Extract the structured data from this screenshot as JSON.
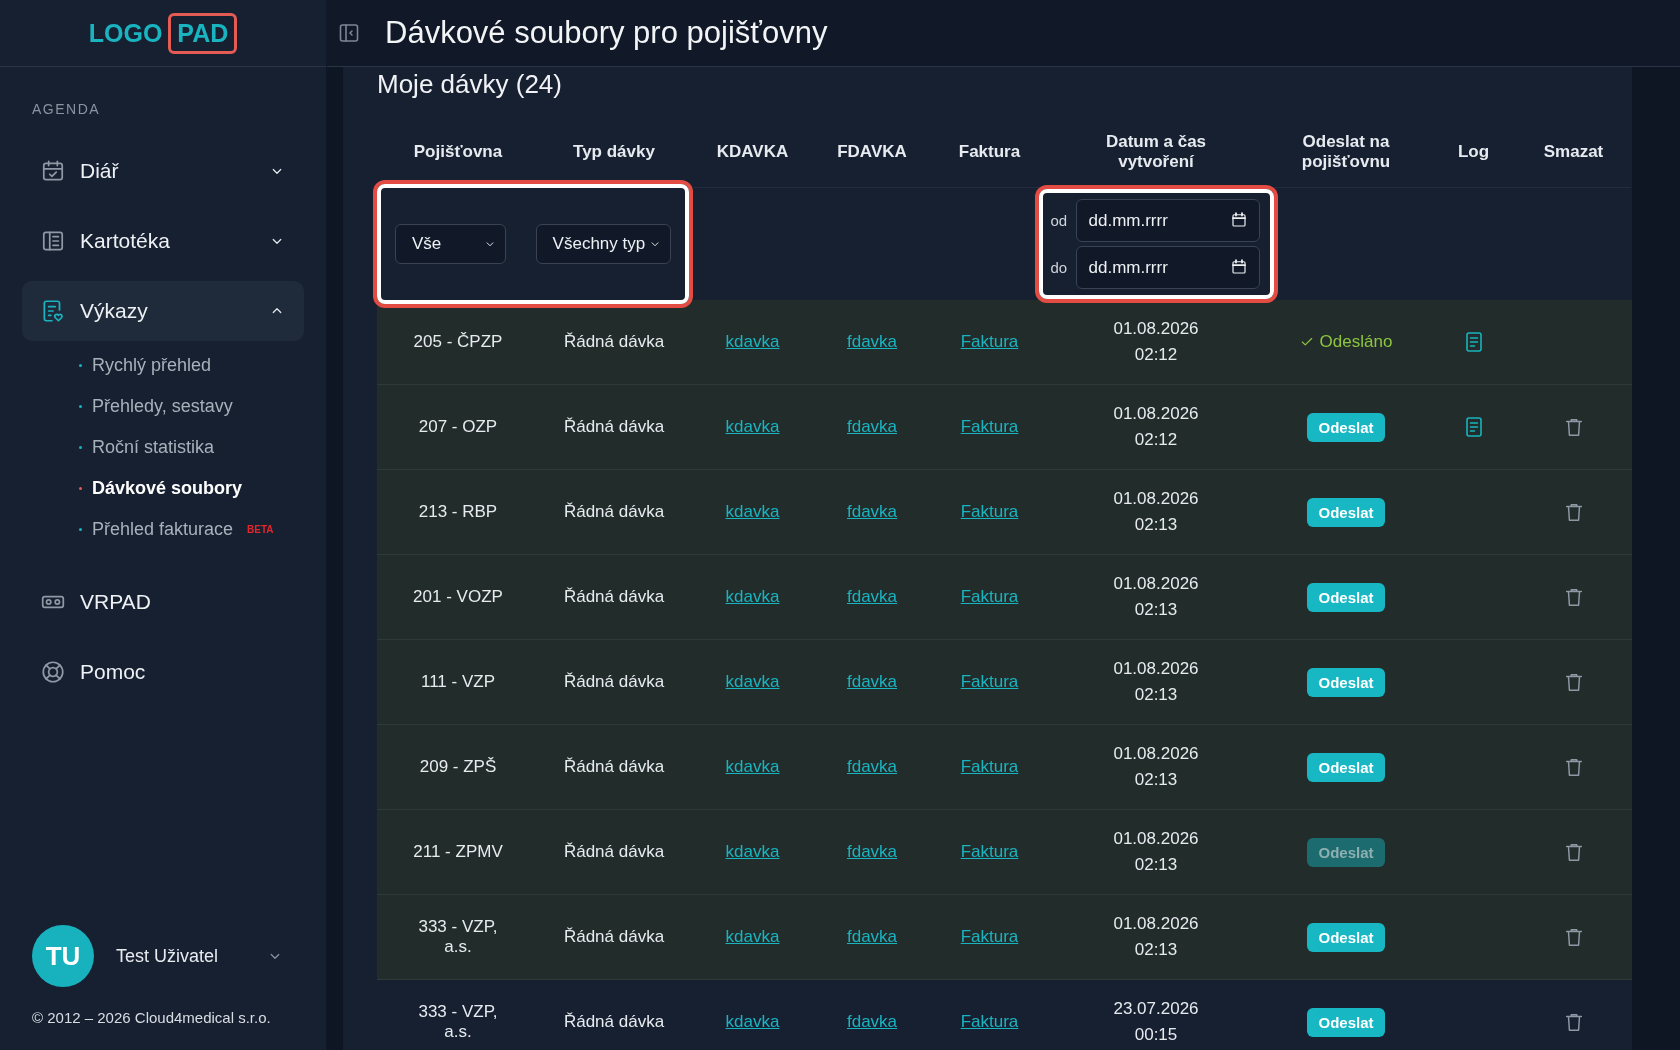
{
  "logo": {
    "text": "LOGO",
    "boxed_text": "PAD"
  },
  "sidebar": {
    "section_label": "AGENDA",
    "items": [
      {
        "label": "Diář",
        "kind": "group",
        "expanded": false,
        "selected": false
      },
      {
        "label": "Kartotéka",
        "kind": "group",
        "expanded": false,
        "selected": false
      },
      {
        "label": "Výkazy",
        "kind": "group",
        "expanded": true,
        "selected": true,
        "children": [
          {
            "label": "Rychlý přehled",
            "selected": false
          },
          {
            "label": "Přehledy, sestavy",
            "selected": false
          },
          {
            "label": "Roční statistika",
            "selected": false
          },
          {
            "label": "Dávkové soubory",
            "selected": true
          },
          {
            "label": "Přehled fakturace",
            "selected": false,
            "badge": "BETA"
          }
        ]
      },
      {
        "label": "VRPAD",
        "kind": "link",
        "selected": false
      },
      {
        "label": "Pomoc",
        "kind": "link",
        "selected": false
      }
    ]
  },
  "user": {
    "initials": "TU",
    "name": "Test Uživatel"
  },
  "copyright": "© 2012 – 2026 Cloud4medical s.r.o.",
  "header": {
    "title": "Dávkové soubory pro pojišťovny"
  },
  "card": {
    "title": "Moje dávky (24)"
  },
  "table": {
    "columns": [
      "Pojišťovna",
      "Typ dávky",
      "KDAVKA",
      "FDAVKA",
      "Faktura",
      "Datum a čas vytvoření",
      "Odeslat na pojišťovnu",
      "Log",
      "Smazat"
    ],
    "filters": {
      "insurer_select": {
        "value": "Vše",
        "highlighted": true
      },
      "type_select": {
        "value": "Všechny typ"
      },
      "date_range": {
        "highlighted": true,
        "from": {
          "label": "od",
          "placeholder": "dd.mm.rrrr"
        },
        "to": {
          "label": "do",
          "placeholder": "dd.mm.rrrr"
        }
      }
    },
    "rows": [
      {
        "insurer": "205 - ČPZP",
        "type": "Řádná dávka",
        "kdavka": "kdavka",
        "fdavka": "fdavka",
        "invoice": "Faktura",
        "date": "01.08.2026",
        "time": "02:12",
        "send": {
          "kind": "sent",
          "label": "Odesláno"
        },
        "has_log": true,
        "deletable": false,
        "highlighted": true
      },
      {
        "insurer": "207 - OZP",
        "type": "Řádná dávka",
        "kdavka": "kdavka",
        "fdavka": "fdavka",
        "invoice": "Faktura",
        "date": "01.08.2026",
        "time": "02:12",
        "send": {
          "kind": "button",
          "label": "Odeslat",
          "disabled": false
        },
        "has_log": true,
        "deletable": true,
        "highlighted": true
      },
      {
        "insurer": "213 - RBP",
        "type": "Řádná dávka",
        "kdavka": "kdavka",
        "fdavka": "fdavka",
        "invoice": "Faktura",
        "date": "01.08.2026",
        "time": "02:13",
        "send": {
          "kind": "button",
          "label": "Odeslat",
          "disabled": false
        },
        "has_log": false,
        "deletable": true,
        "highlighted": true
      },
      {
        "insurer": "201 - VOZP",
        "type": "Řádná dávka",
        "kdavka": "kdavka",
        "fdavka": "fdavka",
        "invoice": "Faktura",
        "date": "01.08.2026",
        "time": "02:13",
        "send": {
          "kind": "button",
          "label": "Odeslat",
          "disabled": false
        },
        "has_log": false,
        "deletable": true,
        "highlighted": true
      },
      {
        "insurer": "111 - VZP",
        "type": "Řádná dávka",
        "kdavka": "kdavka",
        "fdavka": "fdavka",
        "invoice": "Faktura",
        "date": "01.08.2026",
        "time": "02:13",
        "send": {
          "kind": "button",
          "label": "Odeslat",
          "disabled": false
        },
        "has_log": false,
        "deletable": true,
        "highlighted": true
      },
      {
        "insurer": "209 - ZPŠ",
        "type": "Řádná dávka",
        "kdavka": "kdavka",
        "fdavka": "fdavka",
        "invoice": "Faktura",
        "date": "01.08.2026",
        "time": "02:13",
        "send": {
          "kind": "button",
          "label": "Odeslat",
          "disabled": false
        },
        "has_log": false,
        "deletable": true,
        "highlighted": true
      },
      {
        "insurer": "211 - ZPMV",
        "type": "Řádná dávka",
        "kdavka": "kdavka",
        "fdavka": "fdavka",
        "invoice": "Faktura",
        "date": "01.08.2026",
        "time": "02:13",
        "send": {
          "kind": "button",
          "label": "Odeslat",
          "disabled": true
        },
        "has_log": false,
        "deletable": true,
        "highlighted": true
      },
      {
        "insurer": "333 - VZP, a.s.",
        "type": "Řádná dávka",
        "kdavka": "kdavka",
        "fdavka": "fdavka",
        "invoice": "Faktura",
        "date": "01.08.2026",
        "time": "02:13",
        "send": {
          "kind": "button",
          "label": "Odeslat",
          "disabled": false
        },
        "has_log": false,
        "deletable": true,
        "highlighted": true
      },
      {
        "insurer": "333 - VZP, a.s.",
        "type": "Řádná dávka",
        "kdavka": "kdavka",
        "fdavka": "fdavka",
        "invoice": "Faktura",
        "date": "23.07.2026",
        "time": "00:15",
        "send": {
          "kind": "button",
          "label": "Odeslat",
          "disabled": false
        },
        "has_log": false,
        "deletable": true,
        "highlighted": false
      }
    ]
  }
}
